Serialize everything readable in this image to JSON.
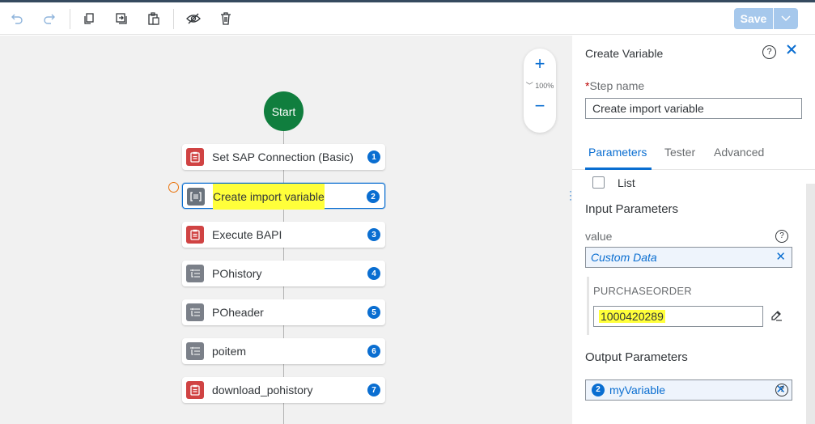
{
  "toolbar": {
    "icons": [
      "undo-icon",
      "redo-icon",
      "copy-icon",
      "duplicate-icon",
      "paste-icon",
      "hide-icon",
      "delete-icon"
    ],
    "save_label": "Save"
  },
  "canvas": {
    "zoom_level": "100%",
    "zoom_prefix": "﹀",
    "start_label": "Start",
    "steps": [
      {
        "label": "Set SAP Connection (Basic)",
        "number": "1",
        "icon": "clipboard-icon",
        "color": "#d04343"
      },
      {
        "label": "Create import variable",
        "number": "2",
        "icon": "variable-icon",
        "color": "#6a737d",
        "selected": true
      },
      {
        "label": "Execute BAPI",
        "number": "3",
        "icon": "clipboard-icon",
        "color": "#d04343"
      },
      {
        "label": "POhistory",
        "number": "4",
        "icon": "list-icon",
        "color": "#7b8089"
      },
      {
        "label": "POheader",
        "number": "5",
        "icon": "list-icon",
        "color": "#7b8089"
      },
      {
        "label": "poitem",
        "number": "6",
        "icon": "list-icon",
        "color": "#7b8089"
      },
      {
        "label": "download_pohistory",
        "number": "7",
        "icon": "clipboard-icon",
        "color": "#d04343"
      }
    ]
  },
  "panel": {
    "title": "Create Variable",
    "help_symbol": "?",
    "step_name_required": "*",
    "step_name_label": "Step name",
    "step_name_value": "Create import variable",
    "tabs": [
      "Parameters",
      "Tester",
      "Advanced"
    ],
    "active_tab": "Parameters",
    "list_label": "List",
    "input_parameters_title": "Input Parameters",
    "value_label": "value",
    "value_token": "Custom Data",
    "purchase_order_label": "PURCHASEORDER",
    "purchase_order_value": "1000420289",
    "output_parameters_title": "Output Parameters",
    "output_number": "2",
    "output_token": "myVariable",
    "remove_symbol": "✕"
  },
  "colors": {
    "accent": "#0a6ed1",
    "start_green": "#107e3e",
    "highlight": "#ffff3a",
    "save_disabled": "#a6c8ec"
  }
}
